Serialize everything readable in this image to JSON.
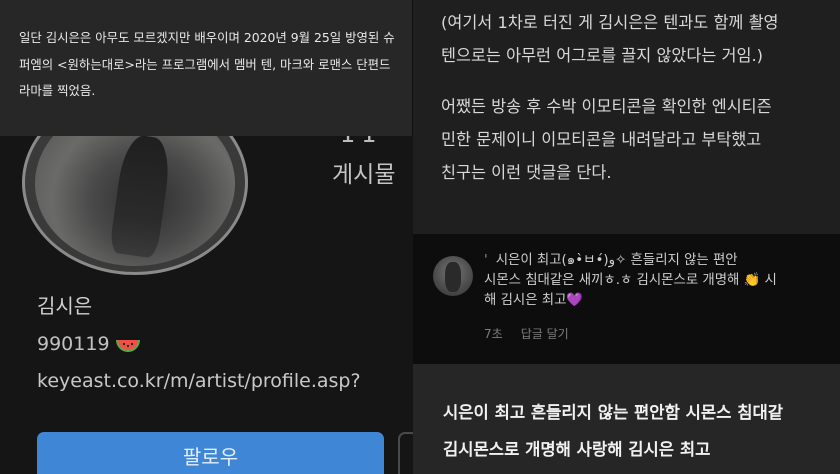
{
  "caption": {
    "text": "일단 김시은은 아무도 모르겠지만 배우이며 2020년 9월 25일 방영된 슈퍼엠의 <원하는대로>라는 프로그램에서 멤버 텐, 마크와 로맨스 단편드라마를 찍었음."
  },
  "profile": {
    "posts_count": "11",
    "posts_label": "게시물",
    "name": "김시은",
    "bio": "990119",
    "bio_icon": "watermelon-icon",
    "link": "keyeast.co.kr/m/artist/profile.asp?",
    "follow_label": "팔로우"
  },
  "article": {
    "para1_line1": "(여기서 1차로 터진 게 김시은은 텐과도 함께 촬영",
    "para1_line2": "텐으로는 아무런 어그로를 끌지 않았다는 거임.)",
    "para2_line1": "어쨌든 방송 후 수박 이모티콘을 확인한 엔시티즌",
    "para2_line2": "민한 문제이니 이모티콘을 내려달라고 부탁했고",
    "para2_line3": "친구는 이런 댓글을 단다."
  },
  "comment": {
    "username": "'",
    "line1": "시은이 최고(๑•̀ㅂ•́)و✧ 흔들리지 않는 편안",
    "line2": "시몬스 침대같은 새끼ㅎ.ㅎ 김시몬스로 개명해 👏 시",
    "line3": "해 김시은 최고💜",
    "time": "7초",
    "reply_label": "답글 달기"
  },
  "quote": {
    "line1": "시은이 최고 흔들리지 않는 편안함 시몬스 침대같",
    "line2": "김시몬스로 개명해 사랑해 김시은 최고"
  }
}
